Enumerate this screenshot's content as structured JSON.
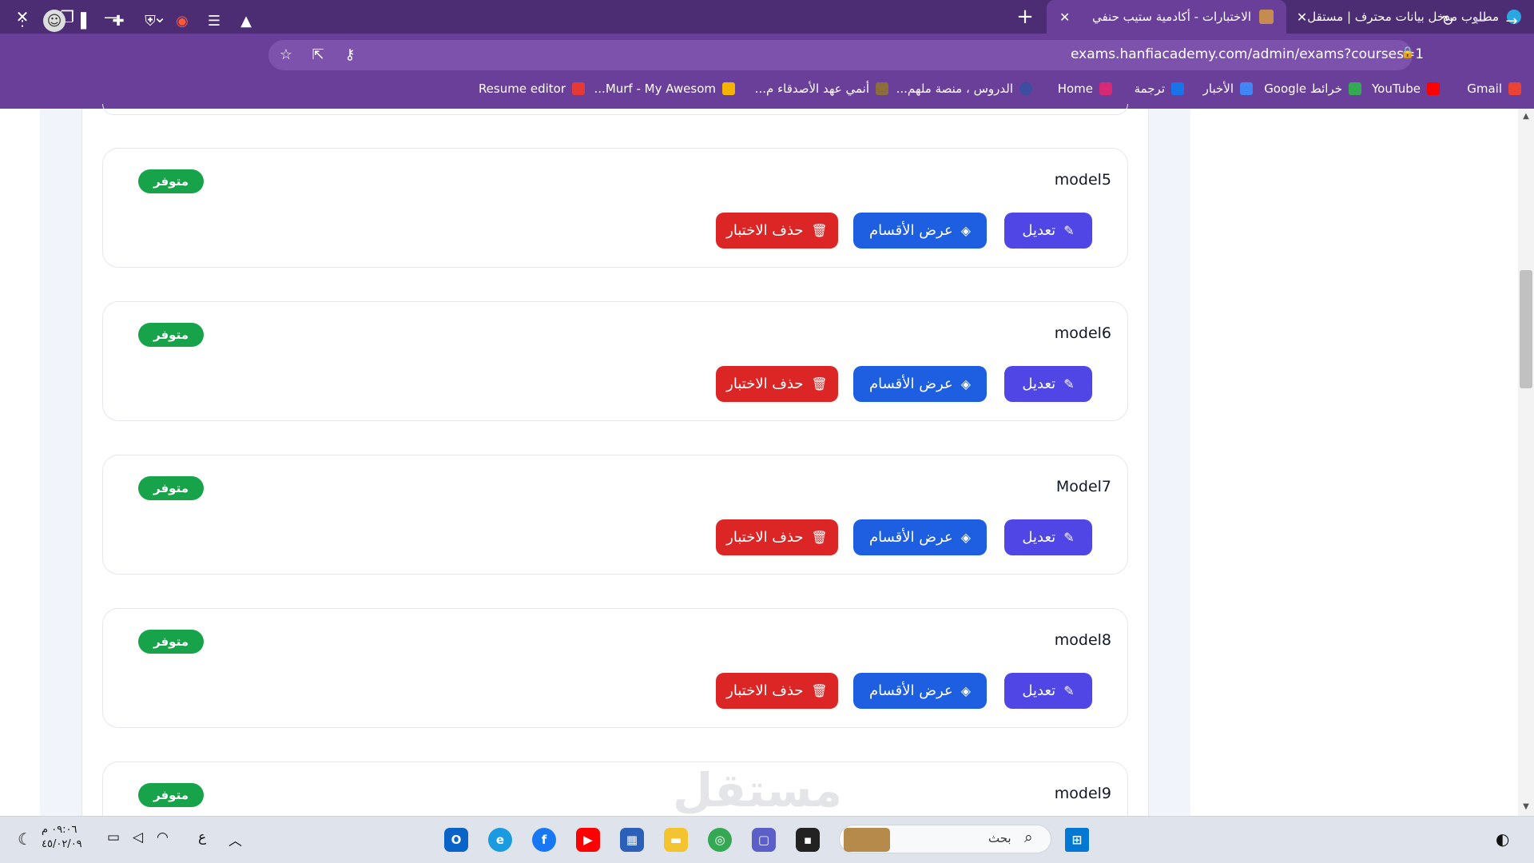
{
  "browser": {
    "tabs": [
      {
        "title": "مطلوب مدخل بيانات محترف | مستقل",
        "active": false
      },
      {
        "title": "الاختبارات - أكادمية ستيب حنفي",
        "active": true
      }
    ],
    "url": "exams.hanfiacademy.com/admin/exams?courses=1",
    "bookmarks": [
      "Gmail",
      "YouTube",
      "خرائط Google",
      "الأخبار",
      "ترجمة",
      "Home",
      "الدروس ، منصة ملهم...",
      "أنمي عهد الأصدقاء م...",
      "Murf - My Awesom...",
      "Resume editor"
    ]
  },
  "exams": [
    {
      "name": "model5",
      "status": "متوفر"
    },
    {
      "name": "model6",
      "status": "متوفر"
    },
    {
      "name": "Model7",
      "status": "متوفر"
    },
    {
      "name": "model8",
      "status": "متوفر"
    },
    {
      "name": "model9",
      "status": "متوفر"
    }
  ],
  "actions": {
    "edit": "تعديل",
    "sections": "عرض الأقسام",
    "delete": "حذف الاختبار"
  },
  "icons": {
    "edit": "edit-icon",
    "sections": "layers-icon",
    "delete": "trash-icon"
  },
  "colors": {
    "accent_purple": "#6a3f9a",
    "edit_button": "#4f46e5",
    "sections_button": "#1d5fe0",
    "delete_button": "#dc2626",
    "available_badge": "#16a34a"
  },
  "taskbar": {
    "search_placeholder": "بحث",
    "language": "ع",
    "time": "٠٩:٠٦ م",
    "date": "٤٥/٠٢/٠٩"
  },
  "watermark": "مستقل"
}
